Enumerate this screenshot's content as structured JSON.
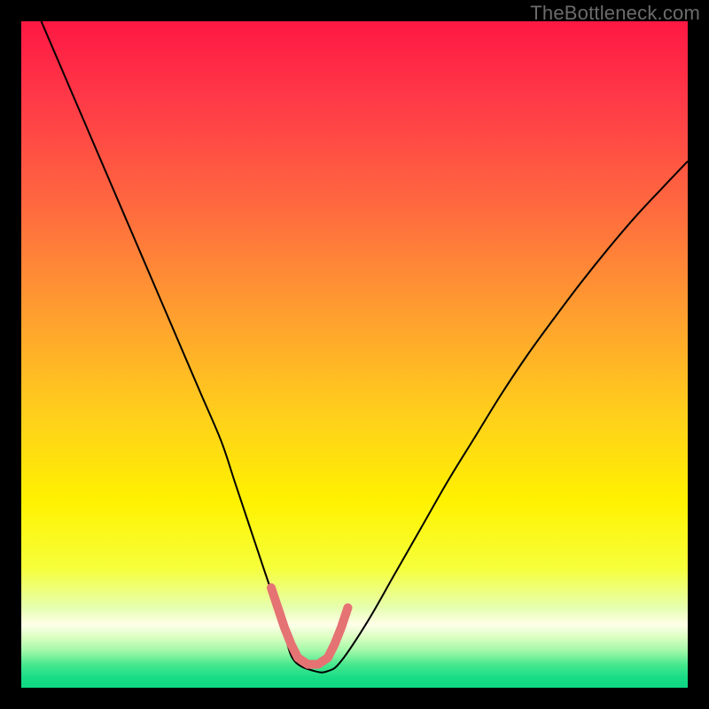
{
  "watermark": "TheBottleneck.com",
  "chart_data": {
    "type": "line",
    "title": "",
    "xlabel": "",
    "ylabel": "",
    "xlim": [
      0,
      100
    ],
    "ylim": [
      0,
      100
    ],
    "grid": false,
    "legend": false,
    "annotations": [],
    "background_gradient": {
      "stops": [
        {
          "pos": 0.0,
          "color": "#ff1844"
        },
        {
          "pos": 0.12,
          "color": "#ff3a47"
        },
        {
          "pos": 0.28,
          "color": "#ff6a3f"
        },
        {
          "pos": 0.45,
          "color": "#ffa22e"
        },
        {
          "pos": 0.6,
          "color": "#ffd21a"
        },
        {
          "pos": 0.72,
          "color": "#fff200"
        },
        {
          "pos": 0.82,
          "color": "#f6ff3a"
        },
        {
          "pos": 0.88,
          "color": "#e6ffb0"
        },
        {
          "pos": 0.905,
          "color": "#ffffe8"
        },
        {
          "pos": 0.925,
          "color": "#d8ffc0"
        },
        {
          "pos": 0.945,
          "color": "#a0f8a8"
        },
        {
          "pos": 0.965,
          "color": "#48e88e"
        },
        {
          "pos": 0.985,
          "color": "#18dc86"
        },
        {
          "pos": 1.0,
          "color": "#0fd682"
        }
      ]
    },
    "series": [
      {
        "name": "bottleneck-curve",
        "stroke": "#000000",
        "stroke_width": 2,
        "x": [
          3,
          6,
          9,
          12,
          15,
          18,
          21,
          24,
          27,
          30,
          32,
          34,
          36,
          38,
          39.5,
          41,
          44,
          46,
          48,
          52,
          56,
          60,
          64,
          68,
          72,
          76,
          80,
          84,
          88,
          92,
          96,
          100
        ],
        "y": [
          100,
          93,
          86,
          79,
          72,
          65,
          58,
          51,
          44,
          37,
          31,
          25,
          19,
          13,
          8,
          4,
          2.5,
          2.5,
          4,
          10,
          17,
          24,
          31,
          37.5,
          44,
          50,
          55.5,
          60.8,
          65.8,
          70.5,
          74.8,
          79
        ]
      },
      {
        "name": "optimal-marker",
        "stroke": "#e57373",
        "stroke_width": 10,
        "linecap": "round",
        "x": [
          37.5,
          38.5,
          39.5,
          40.5,
          41.5,
          43,
          44.5,
          46,
          47,
          48,
          49
        ],
        "y": [
          15,
          12,
          9,
          6.5,
          4.5,
          3.5,
          3.5,
          4.5,
          6.5,
          9,
          12
        ]
      }
    ]
  }
}
